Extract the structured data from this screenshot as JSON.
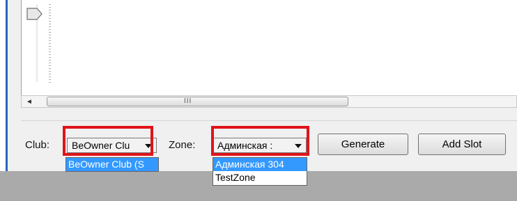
{
  "controls": {
    "club_label": "Club:",
    "club_value": "BeOwner Clu",
    "zone_label": "Zone:",
    "zone_value": "Админская :",
    "generate_label": "Generate",
    "add_slot_label": "Add Slot"
  },
  "club_dropdown": {
    "options": [
      "BeOwner Club (S"
    ]
  },
  "zone_dropdown": {
    "options": [
      "Админская 304",
      "TestZone"
    ]
  },
  "scrollbar": {
    "left_arrow": "◄",
    "grip": "III"
  },
  "highlight_color": "#e0141a",
  "selection_color": "#3399ff"
}
